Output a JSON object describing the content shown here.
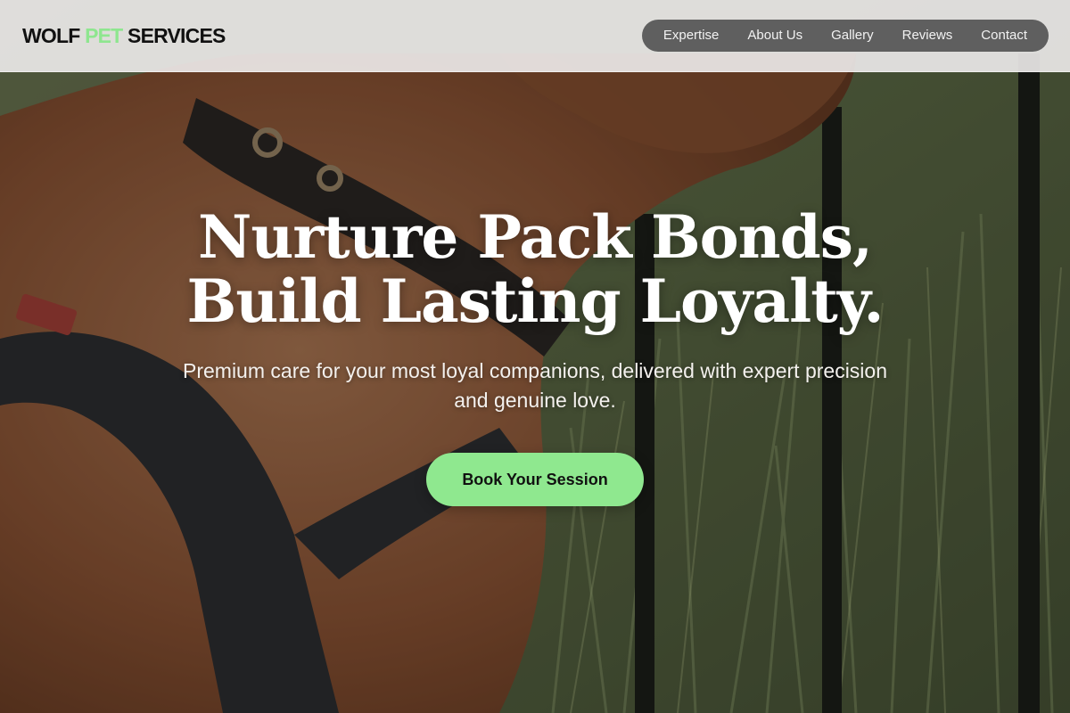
{
  "brand": {
    "logo_part1": "WOLF ",
    "logo_accent": "PET",
    "logo_part2": " SERVICES",
    "accent_color": "#8ee68f"
  },
  "nav": {
    "items": [
      {
        "label": "Expertise"
      },
      {
        "label": "About Us"
      },
      {
        "label": "Gallery"
      },
      {
        "label": "Reviews"
      },
      {
        "label": "Contact"
      }
    ]
  },
  "hero": {
    "headline_line1": "Nurture Pack Bonds,",
    "headline_line2": "Build Lasting Loyalty.",
    "subtitle": "Premium care for your most loyal companions, delivered with expert precision and genuine love.",
    "cta_label": "Book Your Session",
    "cta_color": "#8fe88f"
  }
}
